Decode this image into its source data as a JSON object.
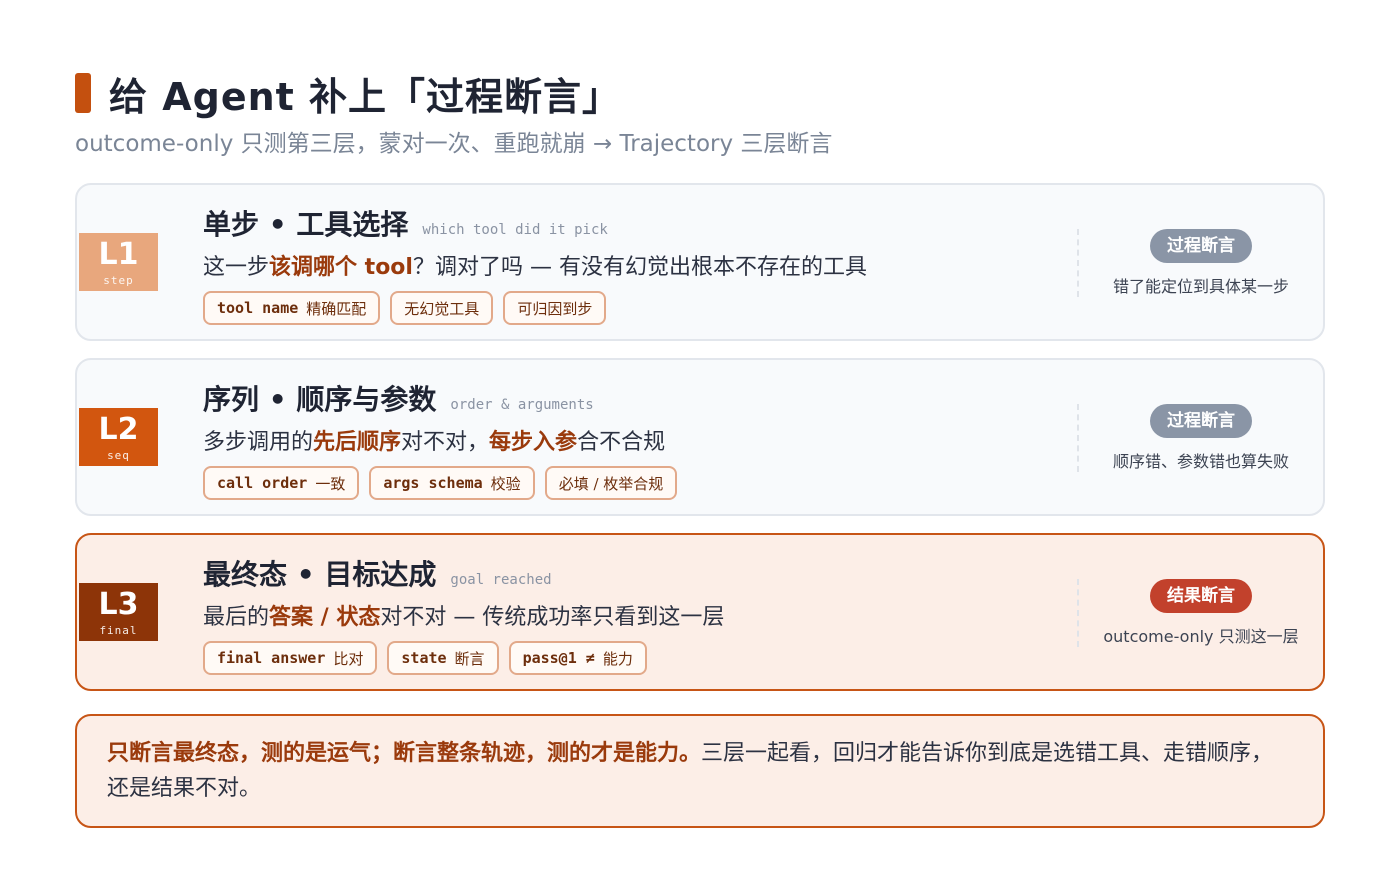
{
  "title": "给 Agent 补上「过程断言」",
  "subtitle": "outcome-only 只测第三层，蒙对一次、重跑就崩 → Trajectory 三层断言",
  "colors": {
    "accent": "#c4500f",
    "l1": "#e8a77d",
    "l2": "#d2560f",
    "l3": "#8d3408",
    "badge_process": "#8a95a6",
    "badge_result": "#c2412c"
  },
  "levels": [
    {
      "code": "L1",
      "code_sub": "step",
      "title": "单步 • 工具选择",
      "title_en": "which tool did it pick",
      "desc": [
        {
          "t": "这一步",
          "b": false
        },
        {
          "t": "该调哪个 tool",
          "b": true
        },
        {
          "t": "？调对了吗 — 有没有幻觉出根本不存在的工具",
          "b": false
        }
      ],
      "chips": [
        {
          "mono": "tool name",
          "text": "精确匹配"
        },
        {
          "mono": "",
          "text": "无幻觉工具"
        },
        {
          "mono": "",
          "text": "可归因到步"
        }
      ],
      "badge": "过程断言",
      "badge_kind": "process",
      "note": "错了能定位到具体某一步"
    },
    {
      "code": "L2",
      "code_sub": "seq",
      "title": "序列 • 顺序与参数",
      "title_en": "order & arguments",
      "desc": [
        {
          "t": "多步调用的",
          "b": false
        },
        {
          "t": "先后顺序",
          "b": true
        },
        {
          "t": "对不对，",
          "b": false
        },
        {
          "t": "每步入参",
          "b": true
        },
        {
          "t": "合不合规",
          "b": false
        }
      ],
      "chips": [
        {
          "mono": "call order",
          "text": "一致"
        },
        {
          "mono": "args schema",
          "text": "校验"
        },
        {
          "mono": "",
          "text": "必填 / 枚举合规"
        }
      ],
      "badge": "过程断言",
      "badge_kind": "process",
      "note": "顺序错、参数错也算失败"
    },
    {
      "code": "L3",
      "code_sub": "final",
      "title": "最终态 • 目标达成",
      "title_en": "goal reached",
      "desc": [
        {
          "t": "最后的",
          "b": false
        },
        {
          "t": "答案 / 状态",
          "b": true
        },
        {
          "t": "对不对 — 传统成功率只看到这一层",
          "b": false
        }
      ],
      "chips": [
        {
          "mono": "final answer",
          "text": "比对"
        },
        {
          "mono": "state",
          "text": "断言"
        },
        {
          "mono": "pass@1 ≠",
          "text": "能力"
        }
      ],
      "badge": "结果断言",
      "badge_kind": "result",
      "note": "outcome-only 只测这一层"
    }
  ],
  "summary": [
    {
      "t": "只断言最终态，测的是运气；断言整条轨迹，测的才是能力。",
      "b": true
    },
    {
      "t": "三层一起看，回归才能告诉你到底是选错工具、走错顺序，还是结果不对。",
      "b": false
    }
  ]
}
